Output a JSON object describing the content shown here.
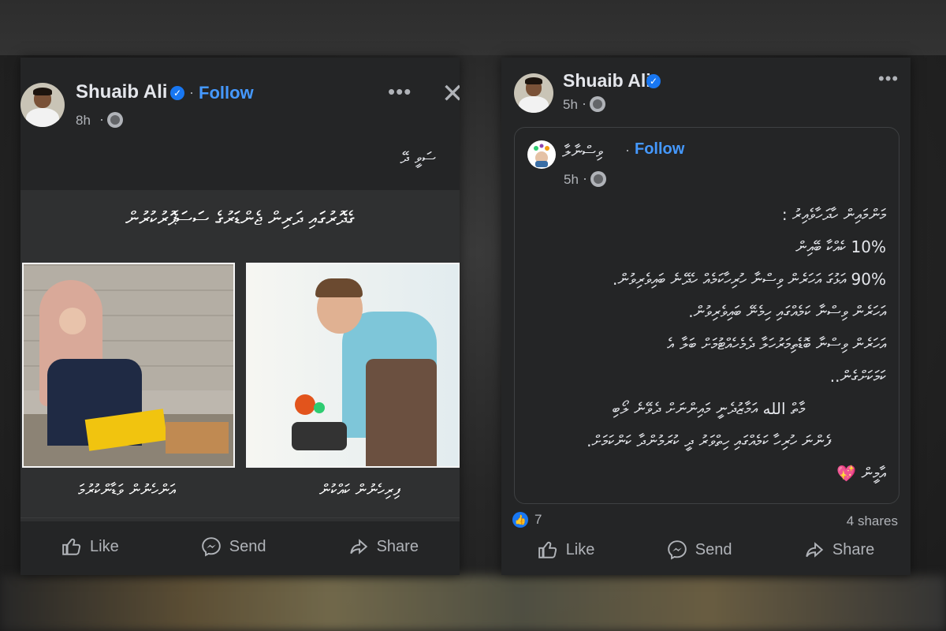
{
  "colors": {
    "panel": "#242526",
    "accent": "#4599ff",
    "verified": "#1877f2",
    "muted": "#b0b3b8"
  },
  "post_left": {
    "author": "Shuaib Ali",
    "follow_label": "Follow",
    "time": "8h",
    "dot": "·",
    "more_icon": "more-horizontal-icon",
    "close_icon": "close-icon",
    "caption": "ސަވީ ދޭ",
    "image": {
      "title": "ގެދޮރުގައި ދަރިން ޖެންޑަރުގެ ސަސަޕޮރުކުރުން",
      "left_label": "އަންހެނުން ވަޑާންކުރުމަ",
      "right_label": "ފިރިހެނުން ކައްކުން"
    },
    "actions": {
      "like": "Like",
      "send": "Send",
      "share": "Share"
    }
  },
  "post_right": {
    "author": "Shuaib Ali",
    "time": "5h",
    "dot": "·",
    "more_icon": "more-horizontal-icon",
    "shared": {
      "name": "ވިސްނާލާ",
      "follow_label": "Follow",
      "time": "5h",
      "body": [
        "މަންމައިން ހާދަހާވެއިރު :",
        "10% ކެއްކާ ބޭއިން",
        "90% އަޅުގަ އަހަރެން ވިސްނާ ހުރިހާކަމެއް ހެދޭނެ ބައިވެރިވުން.",
        "އަހަރެން ވިސްނާ ކަމެއްގައި ހިމެނޭ ބައިވެރިވުން.",
        "އަހަރެން ވިސްނާ ބޮޑެތިމަރުހަލާ ދެމެހެއްޓުމަށް ބަލާ އެ",
        "ކަމަކަށްގެން..",
        "މާތް الله އަމާޒުދެނީ މައިންނަށް ދެވޭނެ ލޯބި",
        "ފެންނަ ހުރިހާ ކަމެއްގައި ހިތްވަރު ދީ ކުރަމުންދާ ކަންކަމަށް.",
        "އާމީން"
      ],
      "closing_emoji": "💖"
    },
    "reactions": {
      "count": "7",
      "shares": "4 shares"
    },
    "actions": {
      "like": "Like",
      "send": "Send",
      "share": "Share"
    }
  }
}
